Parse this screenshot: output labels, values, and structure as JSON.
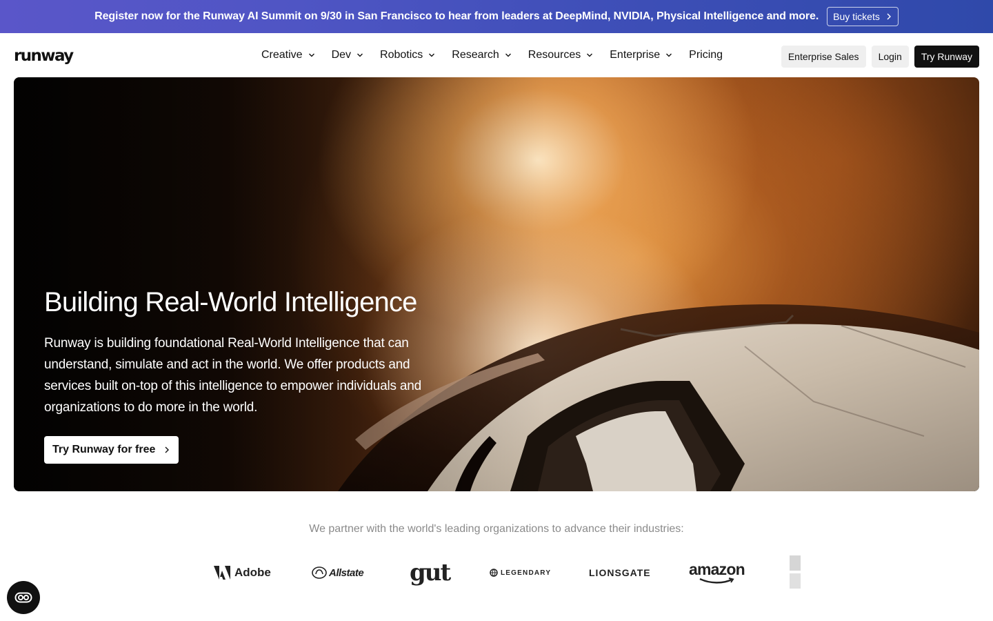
{
  "banner": {
    "text": "Register now for the Runway AI Summit on 9/30 in San Francisco to hear from leaders at DeepMind, NVIDIA, Physical Intelligence and more.",
    "button_label": "Buy tickets"
  },
  "header": {
    "logo": "runway",
    "nav": [
      {
        "label": "Creative",
        "has_dropdown": true
      },
      {
        "label": "Dev",
        "has_dropdown": true
      },
      {
        "label": "Robotics",
        "has_dropdown": true
      },
      {
        "label": "Research",
        "has_dropdown": true
      },
      {
        "label": "Resources",
        "has_dropdown": true
      },
      {
        "label": "Enterprise",
        "has_dropdown": true
      },
      {
        "label": "Pricing",
        "has_dropdown": false
      }
    ],
    "enterprise_sales_label": "Enterprise Sales",
    "login_label": "Login",
    "try_label": "Try Runway"
  },
  "hero": {
    "title": "Building Real-World Intelligence",
    "description": "Runway is building foundational Real-World Intelligence that can understand, simulate and act in the world. We offer products and services built on-top of this intelligence to empower individuals and organizations to do more in the world.",
    "cta_label": "Try Runway for free"
  },
  "partners": {
    "heading": "We partner with the world's leading organizations to advance their industries:",
    "logos": [
      "Adobe",
      "Allstate",
      "gut",
      "LEGENDARY",
      "LIONSGATE",
      "amazon"
    ]
  },
  "colors": {
    "banner_start": "#5a56c9",
    "banner_end": "#2f49aa",
    "primary_dark": "#111111",
    "button_gray": "#efefef",
    "muted_text": "#8a8a8a"
  },
  "icons": [
    "chevron-right-icon",
    "chevron-down-icon",
    "accessibility-icon",
    "adobe-logo-icon",
    "allstate-logo-icon",
    "legendary-globe-icon",
    "amazon-smile-icon"
  ]
}
